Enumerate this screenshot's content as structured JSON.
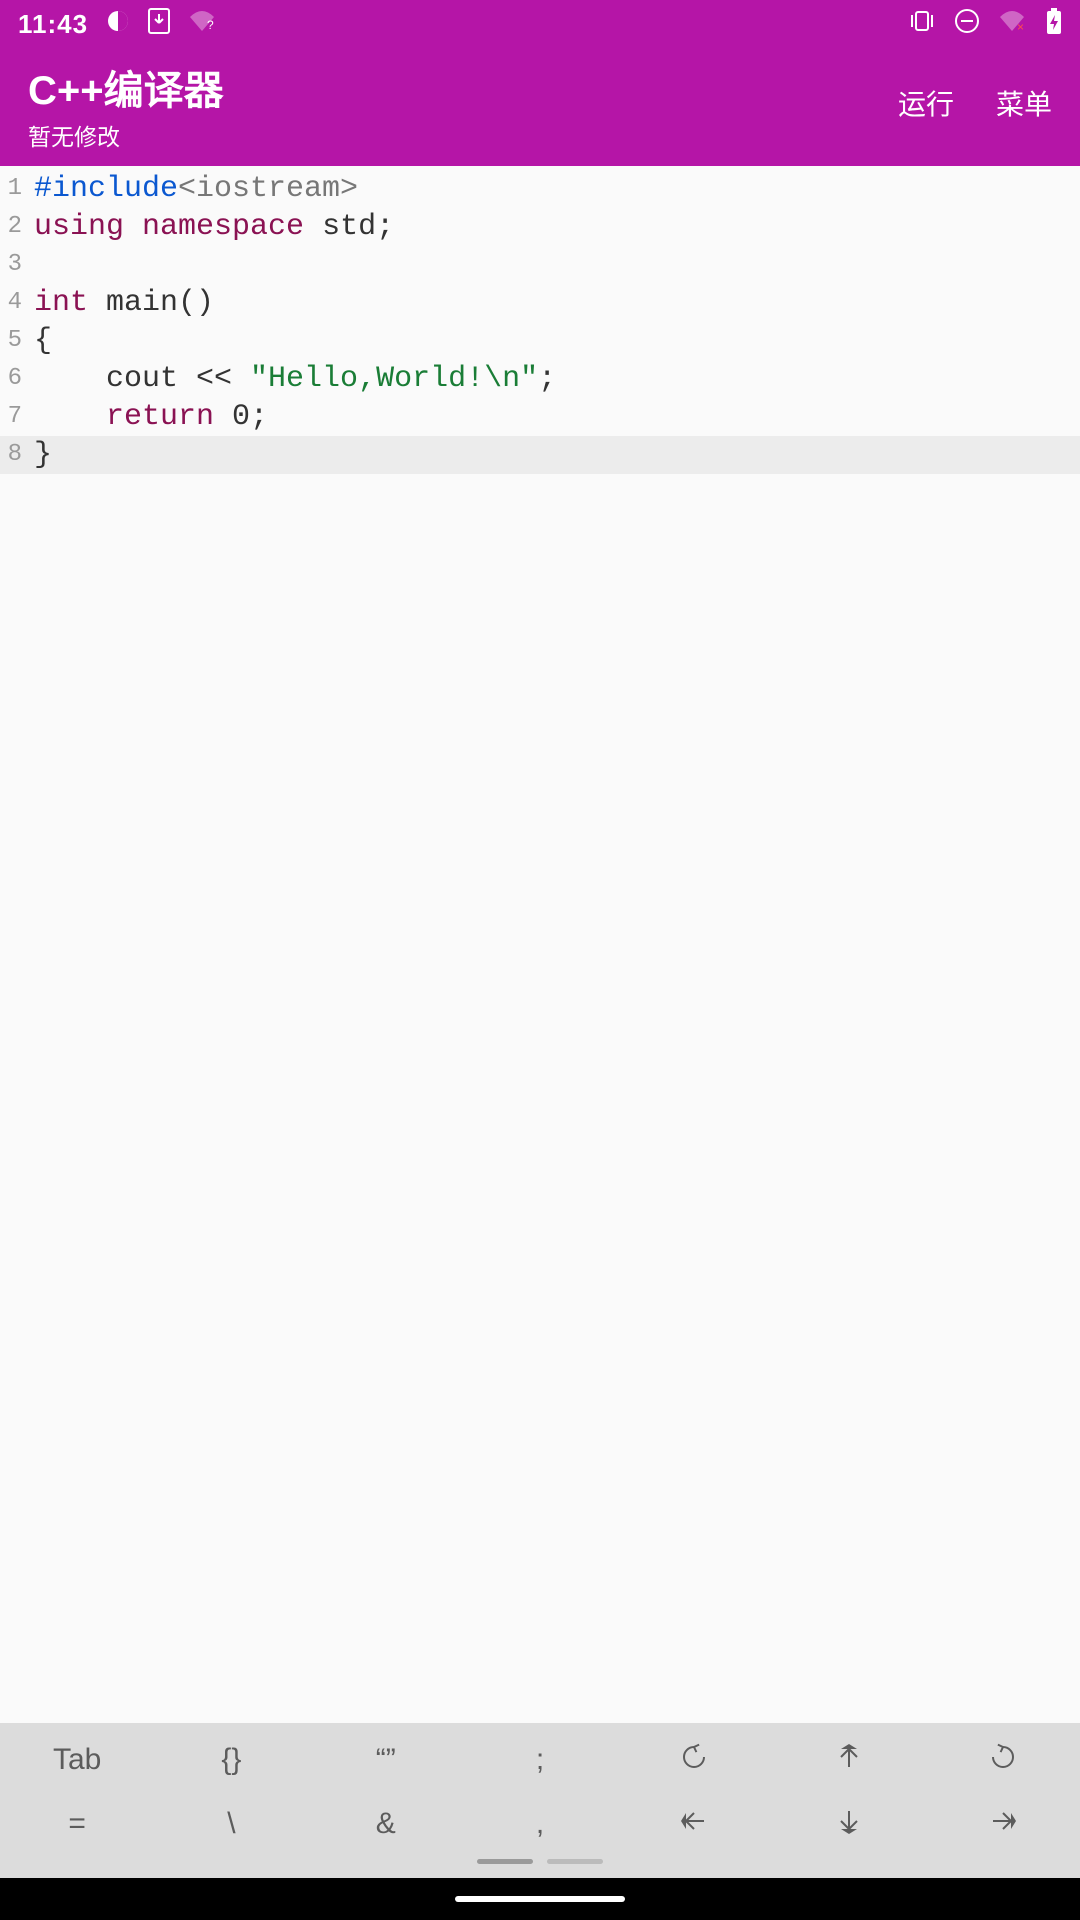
{
  "status": {
    "time": "11:43",
    "icons_left": [
      "contrast-icon",
      "download-box-icon",
      "wifi-question-icon"
    ],
    "icons_right": [
      "vibrate-icon",
      "dnd-icon",
      "wifi-off-icon",
      "battery-charging-icon"
    ]
  },
  "appbar": {
    "title": "C++编译器",
    "subtitle": "暂无修改",
    "run_label": "运行",
    "menu_label": "菜单"
  },
  "editor": {
    "current_line": 8,
    "lines": [
      {
        "n": 1,
        "tokens": [
          [
            "#include",
            "include"
          ],
          [
            "<iostream>",
            "sys"
          ]
        ]
      },
      {
        "n": 2,
        "tokens": [
          [
            "using",
            "keyword"
          ],
          [
            " ",
            "plain"
          ],
          [
            "namespace",
            "keyword"
          ],
          [
            " std;",
            "plain"
          ]
        ]
      },
      {
        "n": 3,
        "tokens": [
          [
            "",
            "plain"
          ]
        ]
      },
      {
        "n": 4,
        "tokens": [
          [
            "int",
            "type"
          ],
          [
            " main()",
            "plain"
          ]
        ]
      },
      {
        "n": 5,
        "tokens": [
          [
            "{",
            "plain"
          ]
        ]
      },
      {
        "n": 6,
        "tokens": [
          [
            "    cout << ",
            "plain"
          ],
          [
            "\"Hello,World!\\n\"",
            "string"
          ],
          [
            ";",
            "plain"
          ]
        ]
      },
      {
        "n": 7,
        "tokens": [
          [
            "    ",
            "plain"
          ],
          [
            "return",
            "keyword"
          ],
          [
            " 0;",
            "plain"
          ]
        ]
      },
      {
        "n": 8,
        "tokens": [
          [
            "}",
            "plain"
          ]
        ]
      }
    ]
  },
  "toolbar": {
    "rows": [
      [
        {
          "name": "tab-key",
          "label": "Tab",
          "type": "text"
        },
        {
          "name": "braces-key",
          "label": "{}",
          "type": "text"
        },
        {
          "name": "quotes-key",
          "label": "“”",
          "type": "text"
        },
        {
          "name": "semicolon-key",
          "label": ";",
          "type": "text"
        },
        {
          "name": "undo-key",
          "type": "icon",
          "icon": "undo-icon"
        },
        {
          "name": "arrow-up-key",
          "type": "icon",
          "icon": "arrow-up-icon"
        },
        {
          "name": "redo-key",
          "type": "icon",
          "icon": "redo-icon"
        }
      ],
      [
        {
          "name": "equals-key",
          "label": "=",
          "type": "text"
        },
        {
          "name": "backslash-key",
          "label": "\\",
          "type": "text"
        },
        {
          "name": "ampersand-key",
          "label": "&",
          "type": "text"
        },
        {
          "name": "comma-key",
          "label": ",",
          "type": "text"
        },
        {
          "name": "arrow-left-key",
          "type": "icon",
          "icon": "arrow-left-icon"
        },
        {
          "name": "arrow-down-key",
          "type": "icon",
          "icon": "arrow-down-icon"
        },
        {
          "name": "arrow-right-key",
          "type": "icon",
          "icon": "arrow-right-icon"
        }
      ]
    ]
  }
}
